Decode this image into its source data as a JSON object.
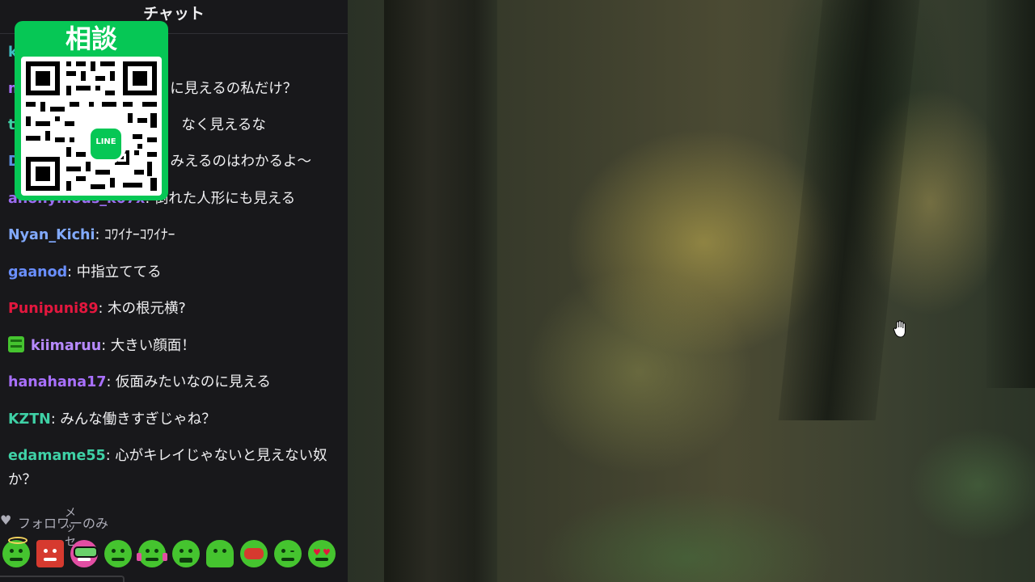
{
  "chat": {
    "title": "チャット",
    "messages": [
      {
        "user": "k",
        "text": "",
        "color": "#3fbfc4"
      },
      {
        "user": "m",
        "text": "に見えるの私だけ？",
        "color": "#a970ff"
      },
      {
        "user": "t",
        "text": "なく見えるな",
        "color": "#3fd1a6"
      },
      {
        "user": "D",
        "text": "みえるのはわかるよ〜",
        "color": "#5c8fe0"
      },
      {
        "user": "anonymous_k07x",
        "text": "倒れた人形にも見える",
        "color": "#9b6cf0"
      },
      {
        "user": "Nyan_Kichi",
        "text": "ｺﾜｲﾅｰｺﾜｲﾅｰ",
        "color": "#82aaff"
      },
      {
        "user": "gaanod",
        "text": "中指立ててる",
        "color": "#6a8fff"
      },
      {
        "user": "Punipuni89",
        "text": "木の根元横?",
        "color": "#e3173e"
      },
      {
        "user": "kiimaruu",
        "text": "大きい顔面！",
        "color": "#b78aff"
      },
      {
        "user": "hanahana17",
        "text": "仮面みたいなのに見える",
        "color": "#a970ff"
      },
      {
        "user": "KZTN",
        "text": "みんな働きすぎじゃね？",
        "color": "#3fd1a6"
      },
      {
        "user": "edamame55",
        "text": "心がキレイじゃないと見えない奴か？",
        "color": "#3fd1a6"
      }
    ],
    "qr": {
      "title": "相談",
      "logo_text": "LINE",
      "accent": "#06c755"
    },
    "follower_only": "フォロワーのみ",
    "stray_text": "メッセ",
    "emotes": [
      "halo-emote",
      "red-box-emote",
      "glasses-emote",
      "smile-emote",
      "headphone-emote",
      "grin-emote",
      "ghost-emote",
      "red-face-emote",
      "wink-emote",
      "heart-eyes-emote"
    ],
    "colors": {
      "background": "#18181b",
      "text": "#efeff1",
      "muted": "#adadb8",
      "emote_green": "#45c42f"
    }
  },
  "video": {
    "cursor_icon": "hand-cursor-icon"
  }
}
